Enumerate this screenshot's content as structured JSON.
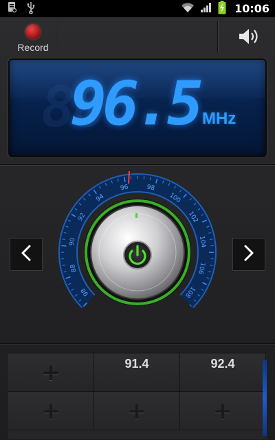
{
  "status_bar": {
    "time": "10:06",
    "icons": [
      "notification-icon",
      "usb-icon",
      "wifi-icon",
      "signal-icon",
      "battery-charging-icon"
    ]
  },
  "toolbar": {
    "record_label": "Record",
    "speaker_icon": "speaker-icon"
  },
  "display": {
    "frequency": "96.5",
    "ghost_digits": "88",
    "unit": "MHz"
  },
  "tuner": {
    "dial_labels": [
      "98",
      "88",
      "90",
      "92",
      "94",
      "96",
      "98",
      "100",
      "102",
      "104",
      "106",
      "108"
    ],
    "power_icon": "power-icon",
    "prev_icon": "chevron-left-icon",
    "next_icon": "chevron-right-icon"
  },
  "presets": {
    "items": [
      {
        "label": "+",
        "type": "empty"
      },
      {
        "label": "91.4",
        "type": "station"
      },
      {
        "label": "92.4",
        "type": "station"
      },
      {
        "label": "+",
        "type": "empty"
      },
      {
        "label": "+",
        "type": "empty"
      },
      {
        "label": "+",
        "type": "empty"
      }
    ]
  },
  "colors": {
    "accent": "#2f9bff",
    "power_green": "#35c42c",
    "record_red": "#c41d1d"
  }
}
